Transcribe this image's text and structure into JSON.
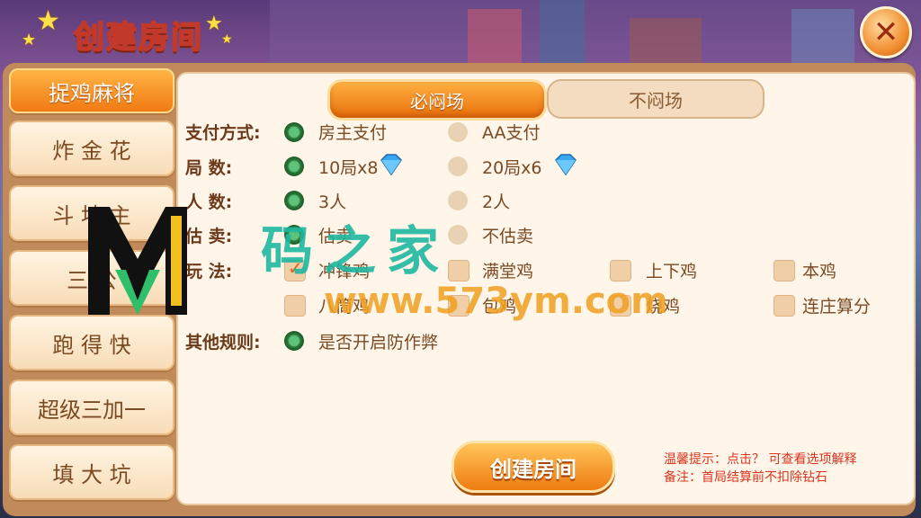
{
  "header": {
    "title": "创建房间",
    "close_icon": "close-icon"
  },
  "sidebar": {
    "items": [
      {
        "label": "捉鸡麻将",
        "active": true
      },
      {
        "label": "炸 金 花"
      },
      {
        "label": "斗 地 主"
      },
      {
        "label": "三 公"
      },
      {
        "label": "跑 得 快"
      },
      {
        "label": "超级三加一"
      },
      {
        "label": "填 大 坑"
      }
    ]
  },
  "mode_tabs": {
    "selected": "必闷场",
    "unselected": "不闷场"
  },
  "rules": {
    "payment": {
      "label": "支付方式:",
      "options": [
        "房主支付",
        "AA支付"
      ],
      "selected": 0
    },
    "rounds": {
      "label": "局 数:",
      "options": [
        "10局x8",
        "20局x6"
      ],
      "selected": 0
    },
    "players": {
      "label": "人 数:",
      "options": [
        "3人",
        "2人"
      ],
      "selected": 0
    },
    "gu_mai": {
      "label": "估 卖:",
      "options": [
        "估卖",
        "不估卖"
      ],
      "selected": 0
    },
    "play": {
      "label": "玩 法:",
      "options": [
        "冲锋鸡",
        "满堂鸡",
        "上下鸡",
        "本鸡",
        "八筒鸡",
        "包鸡",
        "烧鸡",
        "连庄算分"
      ],
      "checked": [
        true,
        false,
        false,
        false,
        false,
        false,
        false,
        false
      ]
    },
    "other": {
      "label": "其他规则:",
      "options": [
        "是否开启防作弊"
      ],
      "selected": 0
    }
  },
  "create_button": "创建房间",
  "tips": {
    "line1": "温馨提示：点击？ 可查看选项解释",
    "line2": "备注：首局结算前不扣除钻石"
  },
  "watermark": {
    "text": "码之家",
    "url": "www.573ym.com"
  },
  "colors": {
    "accent": "#f07a12",
    "radio_on": "#2a7a3a",
    "tip": "#d9351f"
  }
}
